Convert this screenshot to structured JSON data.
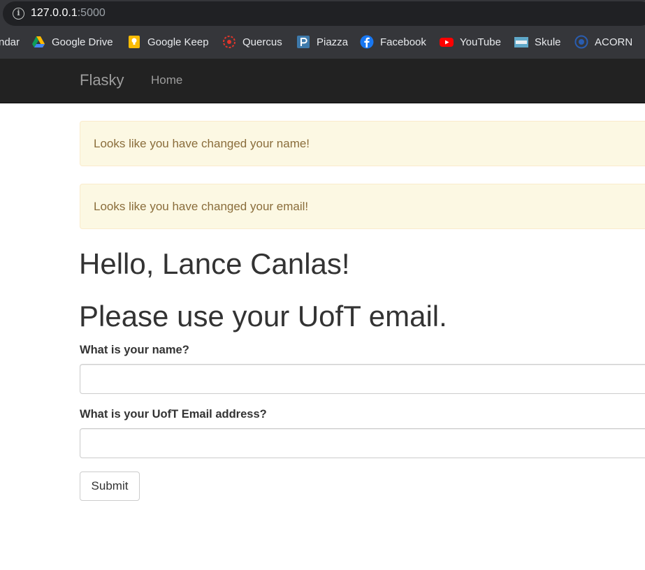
{
  "browser": {
    "url_host": "127.0.0.1",
    "url_port": ":5000",
    "bookmarks": [
      {
        "label": "ndar",
        "icon": "calendar-icon"
      },
      {
        "label": "Google Drive",
        "icon": "google-drive-icon"
      },
      {
        "label": "Google Keep",
        "icon": "google-keep-icon"
      },
      {
        "label": "Quercus",
        "icon": "quercus-icon"
      },
      {
        "label": "Piazza",
        "icon": "piazza-icon"
      },
      {
        "label": "Facebook",
        "icon": "facebook-icon"
      },
      {
        "label": "YouTube",
        "icon": "youtube-icon"
      },
      {
        "label": "Skule",
        "icon": "skule-icon"
      },
      {
        "label": "ACORN",
        "icon": "acorn-icon"
      }
    ]
  },
  "navbar": {
    "brand": "Flasky",
    "links": [
      "Home"
    ]
  },
  "alerts": [
    "Looks like you have changed your name!",
    "Looks like you have changed your email!"
  ],
  "main": {
    "greeting": "Hello, Lance Canlas!",
    "notice": "Please use your UofT email.",
    "form": {
      "name_label": "What is your name?",
      "name_value": "",
      "email_label": "What is your UofT Email address?",
      "email_value": "",
      "submit_label": "Submit"
    }
  },
  "colors": {
    "navbar_bg": "#222222",
    "alert_bg": "#fcf8e3",
    "alert_text": "#8a6d3b"
  }
}
